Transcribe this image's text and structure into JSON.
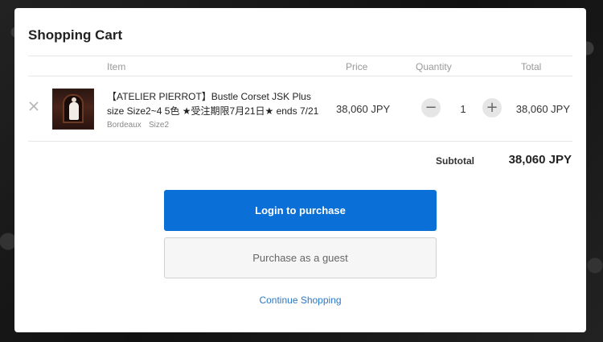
{
  "modal": {
    "title": "Shopping Cart",
    "columns": {
      "item": "Item",
      "price": "Price",
      "quantity": "Quantity",
      "total": "Total"
    }
  },
  "cart": {
    "items": [
      {
        "name": "【ATELIER PIERROT】Bustle Corset JSK Plus size Size2~4 5色 ★受注期限7月21日★ ends 7/21",
        "color": "Bordeaux",
        "size": "Size2",
        "price": "38,060 JPY",
        "quantity": "1",
        "total": "38,060 JPY",
        "decrease_symbol": "−",
        "increase_symbol": "+"
      }
    ],
    "subtotal_label": "Subtotal",
    "subtotal_value": "38,060 JPY"
  },
  "actions": {
    "login_label": "Login to purchase",
    "guest_label": "Purchase as a guest",
    "continue_label": "Continue Shopping"
  },
  "icons": {
    "remove": "close-icon",
    "thumbnail": "product-thumbnail"
  },
  "colors": {
    "primary": "#0a6fd6",
    "link": "#2a78c6"
  }
}
